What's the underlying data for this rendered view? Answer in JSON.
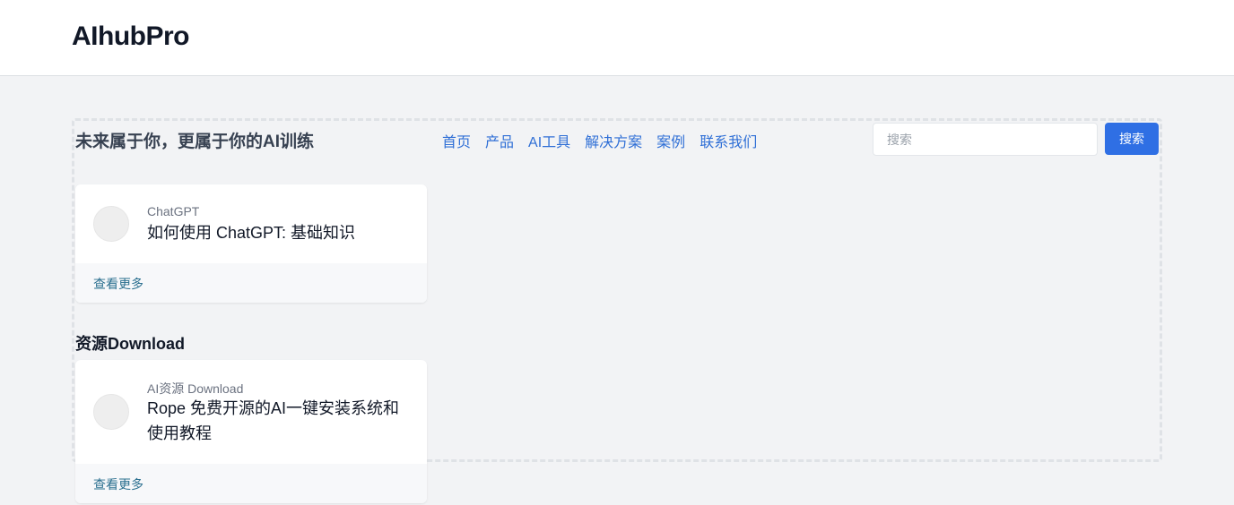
{
  "header": {
    "brand": "AIhubPro"
  },
  "hero": {
    "tagline": "未来属于你，更属于你的AI训练"
  },
  "nav": {
    "items": [
      {
        "label": "首页"
      },
      {
        "label": "产品"
      },
      {
        "label": "AI工具"
      },
      {
        "label": "解决方案"
      },
      {
        "label": "案例"
      },
      {
        "label": "联系我们"
      }
    ]
  },
  "search": {
    "placeholder": "搜索",
    "value": "",
    "button_label": "搜索"
  },
  "cards": [
    {
      "category": "ChatGPT",
      "title": "如何使用 ChatGPT: 基础知识",
      "more_label": "查看更多"
    },
    {
      "category": "AI资源 Download",
      "title": "Rope 免费开源的AI一键安装系统和使用教程",
      "more_label": "查看更多"
    }
  ],
  "sections": {
    "download_heading": "资源Download"
  },
  "colors": {
    "accent": "#2f6fe4",
    "link": "#2f6fd6",
    "background": "#f2f3f5"
  }
}
